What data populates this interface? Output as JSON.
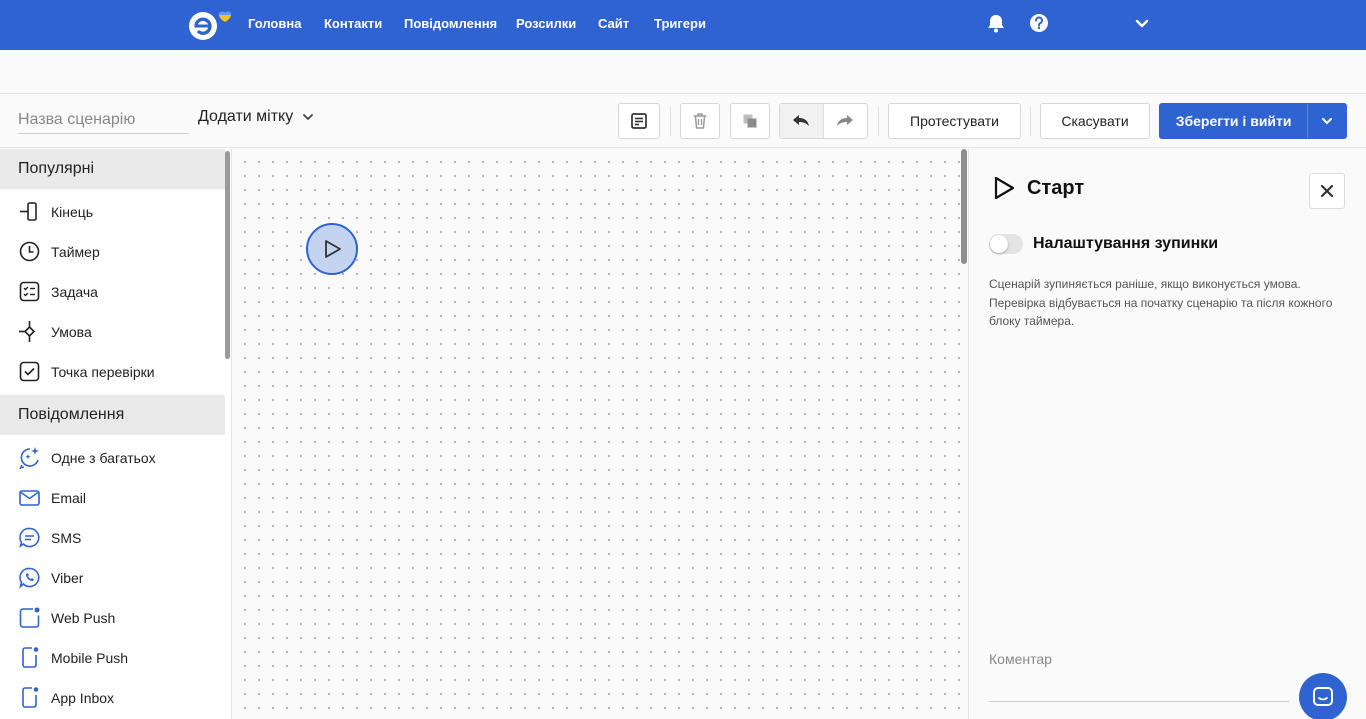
{
  "nav": {
    "items": [
      "Головна",
      "Контакти",
      "Повідомлення",
      "Розсилки",
      "Сайт",
      "Тригери"
    ],
    "icons": [
      "bell-icon",
      "help-icon",
      "chevron-down-icon"
    ]
  },
  "toolbar": {
    "scenario_placeholder": "Назва сценарію",
    "tag_label": "Додати мітку",
    "test_label": "Протестувати",
    "cancel_label": "Скасувати",
    "save_label": "Зберегти і вийти",
    "icons": [
      "notes-icon",
      "trash-icon",
      "copy-icon",
      "undo-icon",
      "redo-icon"
    ]
  },
  "sidebar": {
    "sections": [
      {
        "title": "Популярні",
        "items": [
          {
            "label": "Кінець",
            "icon": "end-icon"
          },
          {
            "label": "Таймер",
            "icon": "timer-icon"
          },
          {
            "label": "Задача",
            "icon": "task-icon"
          },
          {
            "label": "Умова",
            "icon": "condition-icon"
          },
          {
            "label": "Точка перевірки",
            "icon": "checkpoint-icon"
          }
        ]
      },
      {
        "title": "Повідомлення",
        "items": [
          {
            "label": "Одне з багатьох",
            "icon": "sparkle-chat-icon"
          },
          {
            "label": "Email",
            "icon": "email-icon"
          },
          {
            "label": "SMS",
            "icon": "sms-icon"
          },
          {
            "label": "Viber",
            "icon": "viber-icon"
          },
          {
            "label": "Web Push",
            "icon": "web-push-icon"
          },
          {
            "label": "Mobile Push",
            "icon": "mobile-push-icon"
          },
          {
            "label": "App Inbox",
            "icon": "app-inbox-icon"
          }
        ]
      }
    ]
  },
  "panel": {
    "title": "Старт",
    "toggle_label": "Налаштування зупинки",
    "toggle_on": false,
    "description": "Сценарій зупиняється раніше, якщо виконується умова. Перевірка відбувається на початку сценарію та після кожного блоку таймера.",
    "comment_label": "Коментар"
  },
  "colors": {
    "brand": "#2e63d1",
    "start_node_fill": "#c4d3ef",
    "section_bg": "#e9e9e9"
  }
}
